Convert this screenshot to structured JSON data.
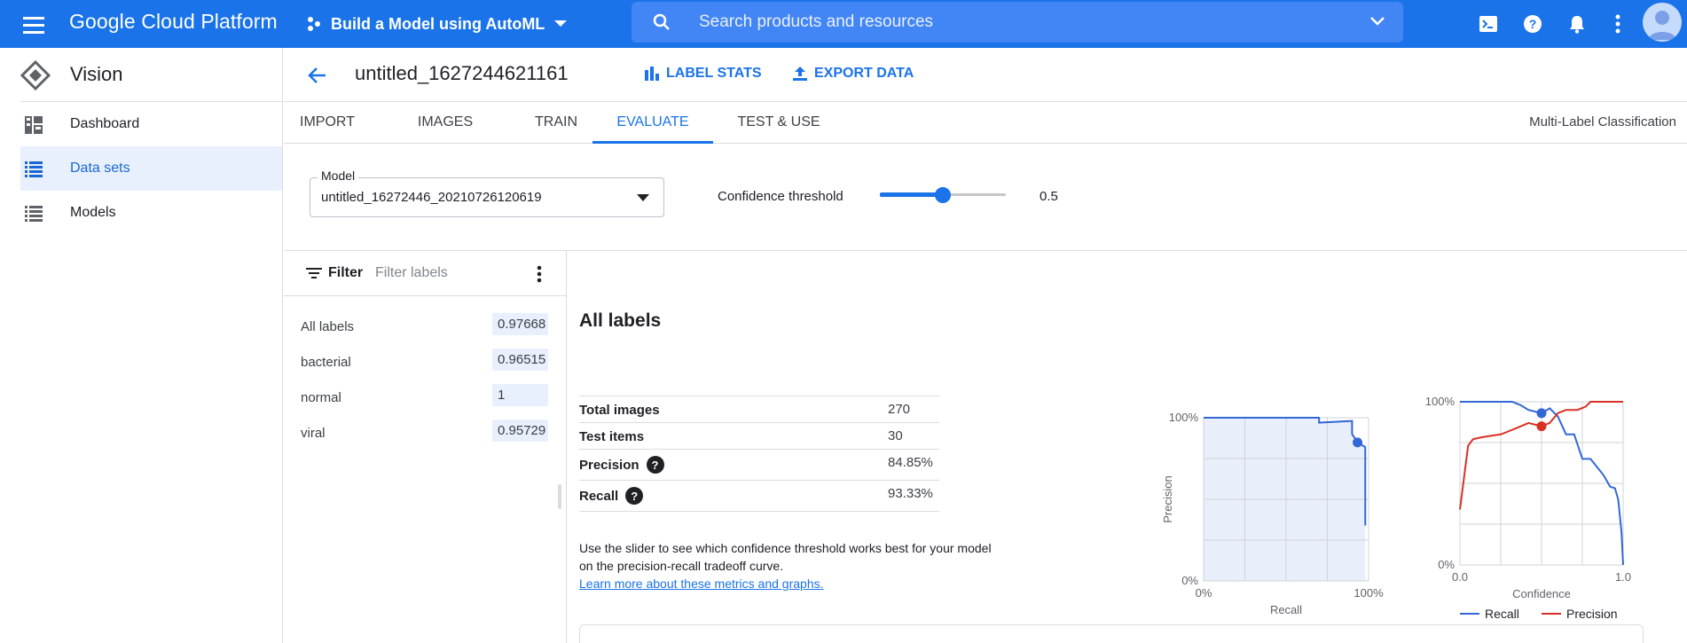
{
  "topbar": {
    "brand": "Google Cloud Platform",
    "project": "Build a Model using AutoML",
    "search_placeholder": "Search products and resources"
  },
  "leftnav": {
    "product": "Vision",
    "items": [
      {
        "label": "Dashboard",
        "icon": "dashboard-icon"
      },
      {
        "label": "Data sets",
        "icon": "list-icon",
        "active": true
      },
      {
        "label": "Models",
        "icon": "list-icon"
      }
    ]
  },
  "header": {
    "title": "untitled_1627244621161",
    "label_stats": "LABEL STATS",
    "export_data": "EXPORT DATA"
  },
  "tabs": {
    "items": [
      "IMPORT",
      "IMAGES",
      "TRAIN",
      "EVALUATE",
      "TEST & USE"
    ],
    "active": "EVALUATE",
    "model_type": "Multi-Label Classification"
  },
  "model_row": {
    "model_legend": "Model",
    "model_value": "untitled_16272446_20210726120619",
    "confidence_label": "Confidence threshold",
    "confidence_value": "0.5",
    "confidence": 0.5
  },
  "filter": {
    "label": "Filter",
    "placeholder": "Filter labels",
    "labels": [
      {
        "name": "All labels",
        "value": "0.97668"
      },
      {
        "name": "bacterial",
        "value": "0.96515"
      },
      {
        "name": "normal",
        "value": "1"
      },
      {
        "name": "viral",
        "value": "0.95729"
      }
    ]
  },
  "main": {
    "title": "All labels",
    "stats": {
      "total_images_label": "Total images",
      "total_images": "270",
      "test_items_label": "Test items",
      "test_items": "30",
      "precision_label": "Precision",
      "precision": "84.85%",
      "recall_label": "Recall",
      "recall": "93.33%"
    },
    "help_text": "Use the slider to see which confidence threshold works best for your model on the precision-recall tradeoff curve.",
    "help_link": "Learn more about these metrics and graphs."
  },
  "colors": {
    "accent": "#1a73e8",
    "recall": "#3367d6",
    "precision": "#d93025"
  },
  "chart_data": [
    {
      "type": "line",
      "xlabel": "Recall",
      "ylabel": "Precision",
      "xlim": [
        0,
        1
      ],
      "ylim": [
        0,
        1
      ],
      "xticks": [
        "0%",
        "100%"
      ],
      "yticks": [
        "0%",
        "100%"
      ],
      "grid": true,
      "filled": true,
      "series": [
        {
          "x": [
            0,
            0.7,
            0.7,
            0.9,
            0.9,
            0.933,
            0.98,
            0.98
          ],
          "y": [
            1,
            1,
            0.97,
            0.98,
            0.9,
            0.85,
            0.82,
            0.34
          ]
        }
      ],
      "marker": {
        "x": 0.933,
        "y": 0.8485
      }
    },
    {
      "type": "line",
      "xlabel": "Confidence",
      "xlim": [
        0,
        1
      ],
      "ylim": [
        0,
        1
      ],
      "xticks": [
        "0.0",
        "1.0"
      ],
      "yticks": [
        "0%",
        "100%"
      ],
      "grid": true,
      "legend": "bottom",
      "series": [
        {
          "name": "Recall",
          "x": [
            0,
            0.12,
            0.22,
            0.32,
            0.37,
            0.42,
            0.5,
            0.55,
            0.6,
            0.65,
            0.7,
            0.75,
            0.8,
            0.84,
            0.88,
            0.92,
            0.95,
            0.97,
            0.99,
            1.0
          ],
          "y": [
            1,
            1,
            1,
            1,
            0.98,
            0.95,
            0.93,
            0.96,
            0.91,
            0.8,
            0.8,
            0.65,
            0.65,
            0.6,
            0.55,
            0.48,
            0.47,
            0.4,
            0.2,
            0.0
          ]
        },
        {
          "name": "Precision",
          "x": [
            0,
            0.05,
            0.08,
            0.12,
            0.18,
            0.25,
            0.3,
            0.35,
            0.42,
            0.5,
            0.55,
            0.6,
            0.65,
            0.72,
            0.77,
            0.8,
            0.9,
            1.0
          ],
          "y": [
            0.34,
            0.73,
            0.77,
            0.78,
            0.79,
            0.8,
            0.82,
            0.84,
            0.87,
            0.85,
            0.87,
            0.93,
            0.95,
            0.95,
            0.97,
            1,
            1,
            1
          ]
        }
      ],
      "markers": [
        {
          "series": "Recall",
          "x": 0.5,
          "y": 0.93
        },
        {
          "series": "Precision",
          "x": 0.5,
          "y": 0.85
        }
      ]
    }
  ]
}
